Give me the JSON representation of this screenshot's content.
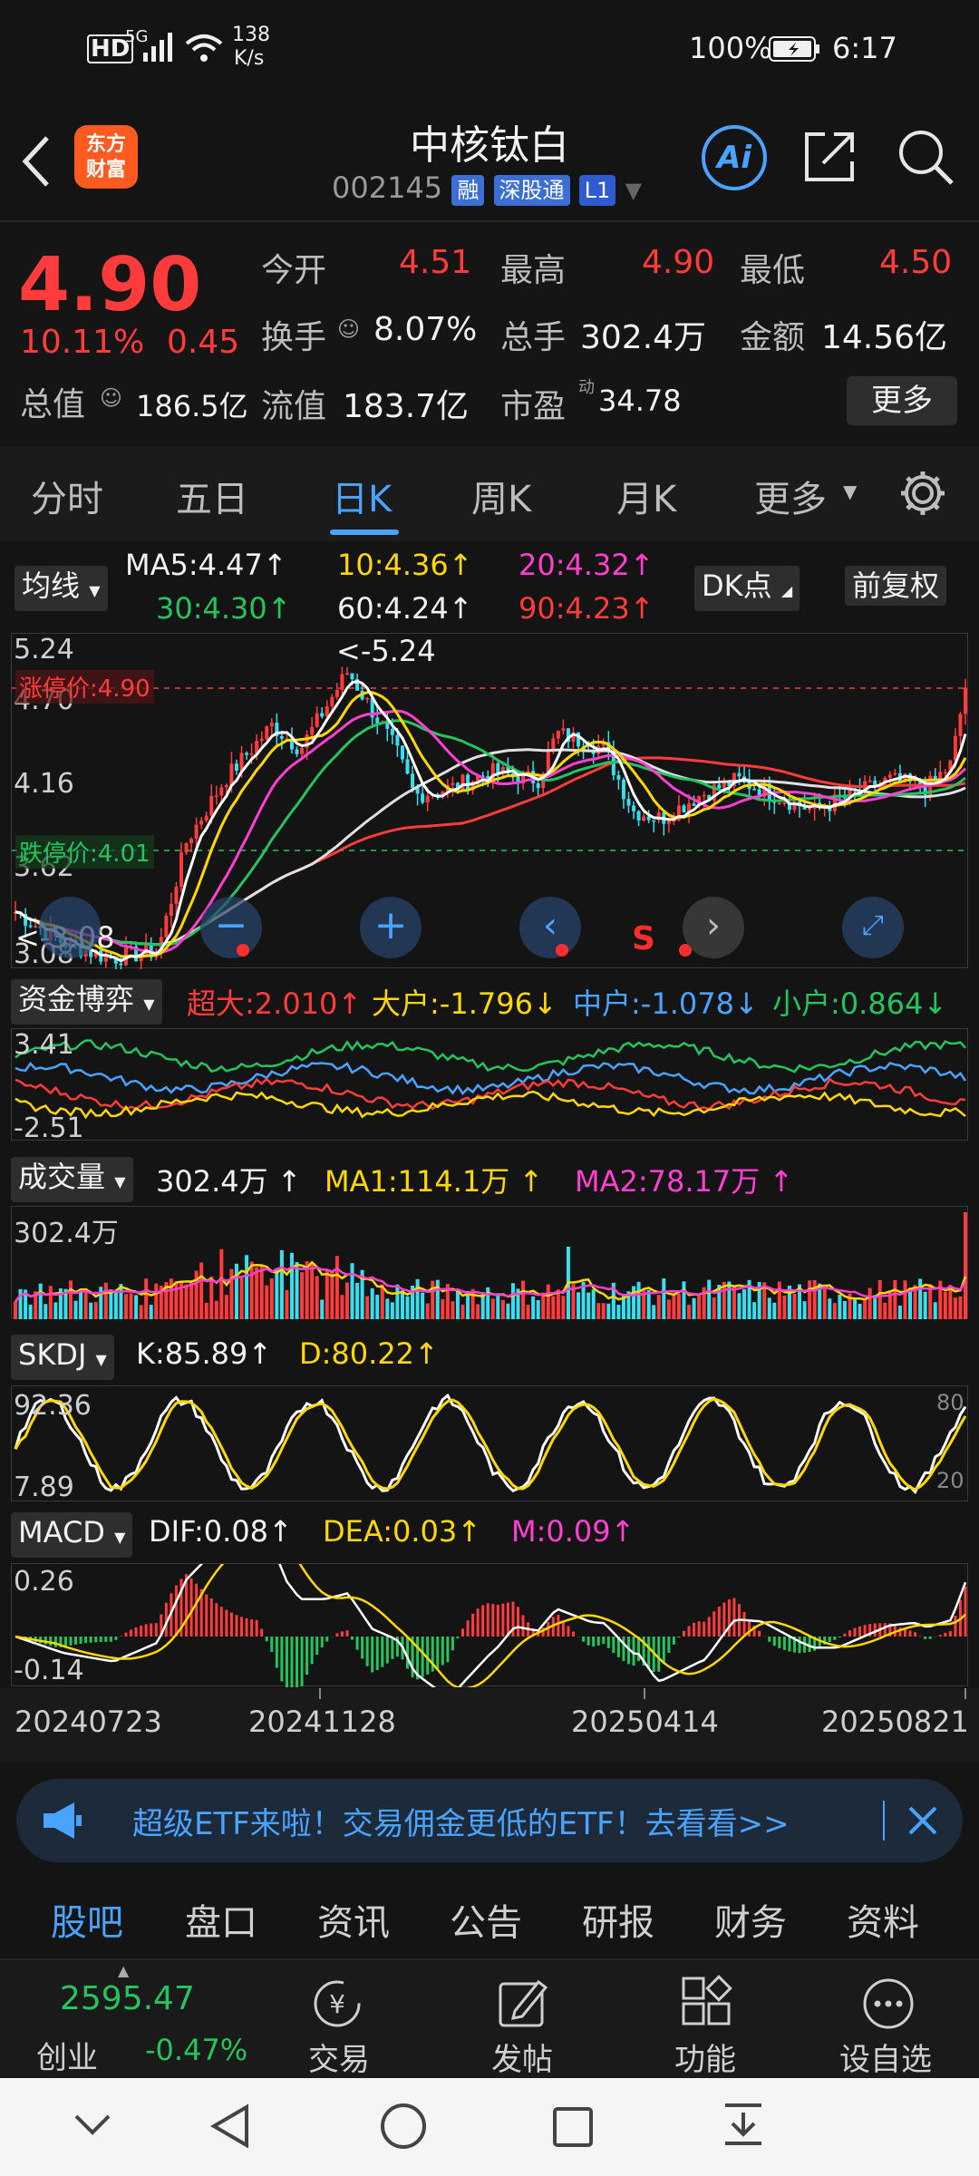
{
  "status_bar": {
    "hd": "HD",
    "network": "5G",
    "speed_value": "138",
    "speed_unit": "K/s",
    "battery": "100%",
    "time": "6:17"
  },
  "header": {
    "logo_line1": "东方",
    "logo_line2": "财富",
    "title": "中核钛白",
    "code": "002145",
    "tag_rong": "融",
    "tag_sgt": "深股通",
    "tag_level": "L1",
    "ai_label": "Ai"
  },
  "quote": {
    "price": "4.90",
    "change_pct": "10.11%",
    "change_amt": "0.45",
    "open_label": "今开",
    "open": "4.51",
    "high_label": "最高",
    "high": "4.90",
    "low_label": "最低",
    "low": "4.50",
    "turnover_label": "换手",
    "turnover": "8.07%",
    "volume_label": "总手",
    "volume": "302.4万",
    "amount_label": "金额",
    "amount": "14.56亿",
    "mktcap_label": "总值",
    "mktcap": "186.5亿",
    "float_label": "流值",
    "float": "183.7亿",
    "pe_label": "市盈",
    "pe_sup": "动",
    "pe": "34.78",
    "more_label": "更多"
  },
  "tabs": [
    "分时",
    "五日",
    "日K",
    "周K",
    "月K",
    "更多"
  ],
  "active_tab": "日K",
  "kline_panel": {
    "ma_chip": "均线",
    "ma5": "MA5:4.47",
    "ma10": "10:4.36",
    "ma20": "20:4.32",
    "ma30": "30:4.30",
    "ma60": "60:4.24",
    "ma90": "90:4.23",
    "dk_chip": "DK点",
    "fq_chip": "前复权",
    "y_top": "5.24",
    "y_2": "4.70",
    "y_3": "4.16",
    "y_4": "3.62",
    "y_bottom": "3.08",
    "high_marker": "<-5.24",
    "low_marker": "<-3.08",
    "limit_up": "涨停价:4.90",
    "limit_down": "跌停价:4.01",
    "s_marker": "S"
  },
  "fund_panel": {
    "chip": "资金博弈",
    "chaoda": "超大:2.010",
    "dahu": "大户:-1.796",
    "zhonghu": "中户:-1.078",
    "xiaohu": "小户:0.864",
    "y_top": "3.41",
    "y_bottom": "-2.51"
  },
  "volume_panel": {
    "chip": "成交量",
    "value": "302.4万",
    "ma1": "MA1:114.1万",
    "ma2": "MA2:78.17万",
    "y_top": "302.4万"
  },
  "skdj_panel": {
    "chip": "SKDJ",
    "k": "K:85.89",
    "d": "D:80.22",
    "y_top": "92.36",
    "y_bottom": "7.89",
    "r_top": "80",
    "r_bottom": "20"
  },
  "macd_panel": {
    "chip": "MACD",
    "dif": "DIF:0.08",
    "dea": "DEA:0.03",
    "m": "M:0.09",
    "y_top": "0.26",
    "y_bottom": "-0.14"
  },
  "x_axis": [
    "20240723",
    "20241128",
    "20250414",
    "20250821"
  ],
  "banner": {
    "text": "超级ETF来啦！交易佣金更低的ETF！去看看>>"
  },
  "sub_tabs": [
    "股吧",
    "盘口",
    "资讯",
    "公告",
    "研报",
    "财务",
    "资料"
  ],
  "active_sub_tab": "股吧",
  "bottom_bar": {
    "index_value": "2595.47",
    "index_name": "创业",
    "index_change": "-0.47%",
    "trade": "交易",
    "post": "发帖",
    "function": "功能",
    "watchlist": "设自选"
  },
  "colors": {
    "up": "#ff3b3b",
    "down": "#22c55e",
    "accent": "#4aa3ff",
    "ma5": "#ffffff",
    "ma10": "#ffd800",
    "ma20": "#ff3fd1",
    "ma30": "#22c55e",
    "ma60": "#e0e0e0",
    "ma90": "#ff3b3b"
  }
}
